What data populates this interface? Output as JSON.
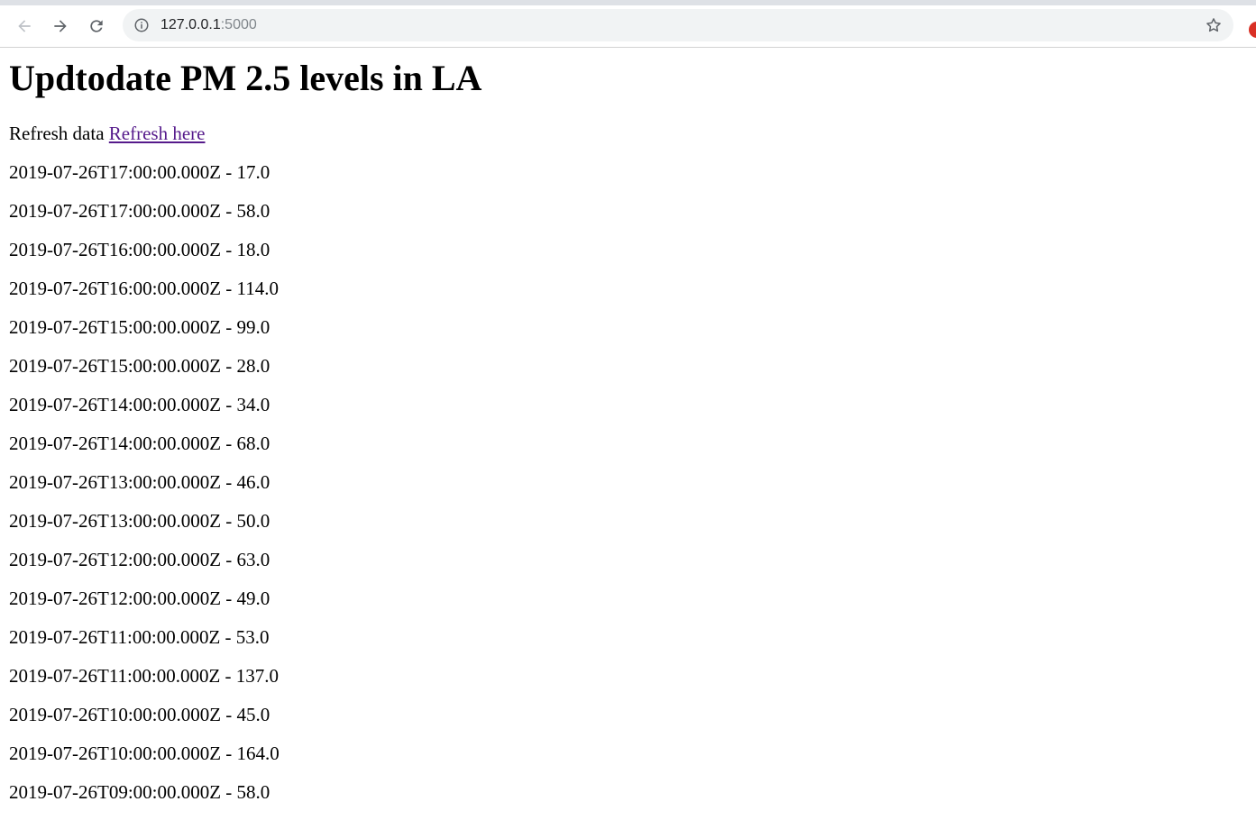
{
  "browser": {
    "url_host": "127.0.0.1",
    "url_port": ":5000"
  },
  "page": {
    "title": "Updtodate PM 2.5 levels in LA",
    "refresh_prefix": "Refresh data",
    "refresh_link": "Refresh here",
    "readings": [
      "2019-07-26T17:00:00.000Z - 17.0",
      "2019-07-26T17:00:00.000Z - 58.0",
      "2019-07-26T16:00:00.000Z - 18.0",
      "2019-07-26T16:00:00.000Z - 114.0",
      "2019-07-26T15:00:00.000Z - 99.0",
      "2019-07-26T15:00:00.000Z - 28.0",
      "2019-07-26T14:00:00.000Z - 34.0",
      "2019-07-26T14:00:00.000Z - 68.0",
      "2019-07-26T13:00:00.000Z - 46.0",
      "2019-07-26T13:00:00.000Z - 50.0",
      "2019-07-26T12:00:00.000Z - 63.0",
      "2019-07-26T12:00:00.000Z - 49.0",
      "2019-07-26T11:00:00.000Z - 53.0",
      "2019-07-26T11:00:00.000Z - 137.0",
      "2019-07-26T10:00:00.000Z - 45.0",
      "2019-07-26T10:00:00.000Z - 164.0",
      "2019-07-26T09:00:00.000Z - 58.0"
    ]
  },
  "colors": {
    "link_visited": "#551a8b",
    "omnibox_bg": "#f1f3f4"
  }
}
